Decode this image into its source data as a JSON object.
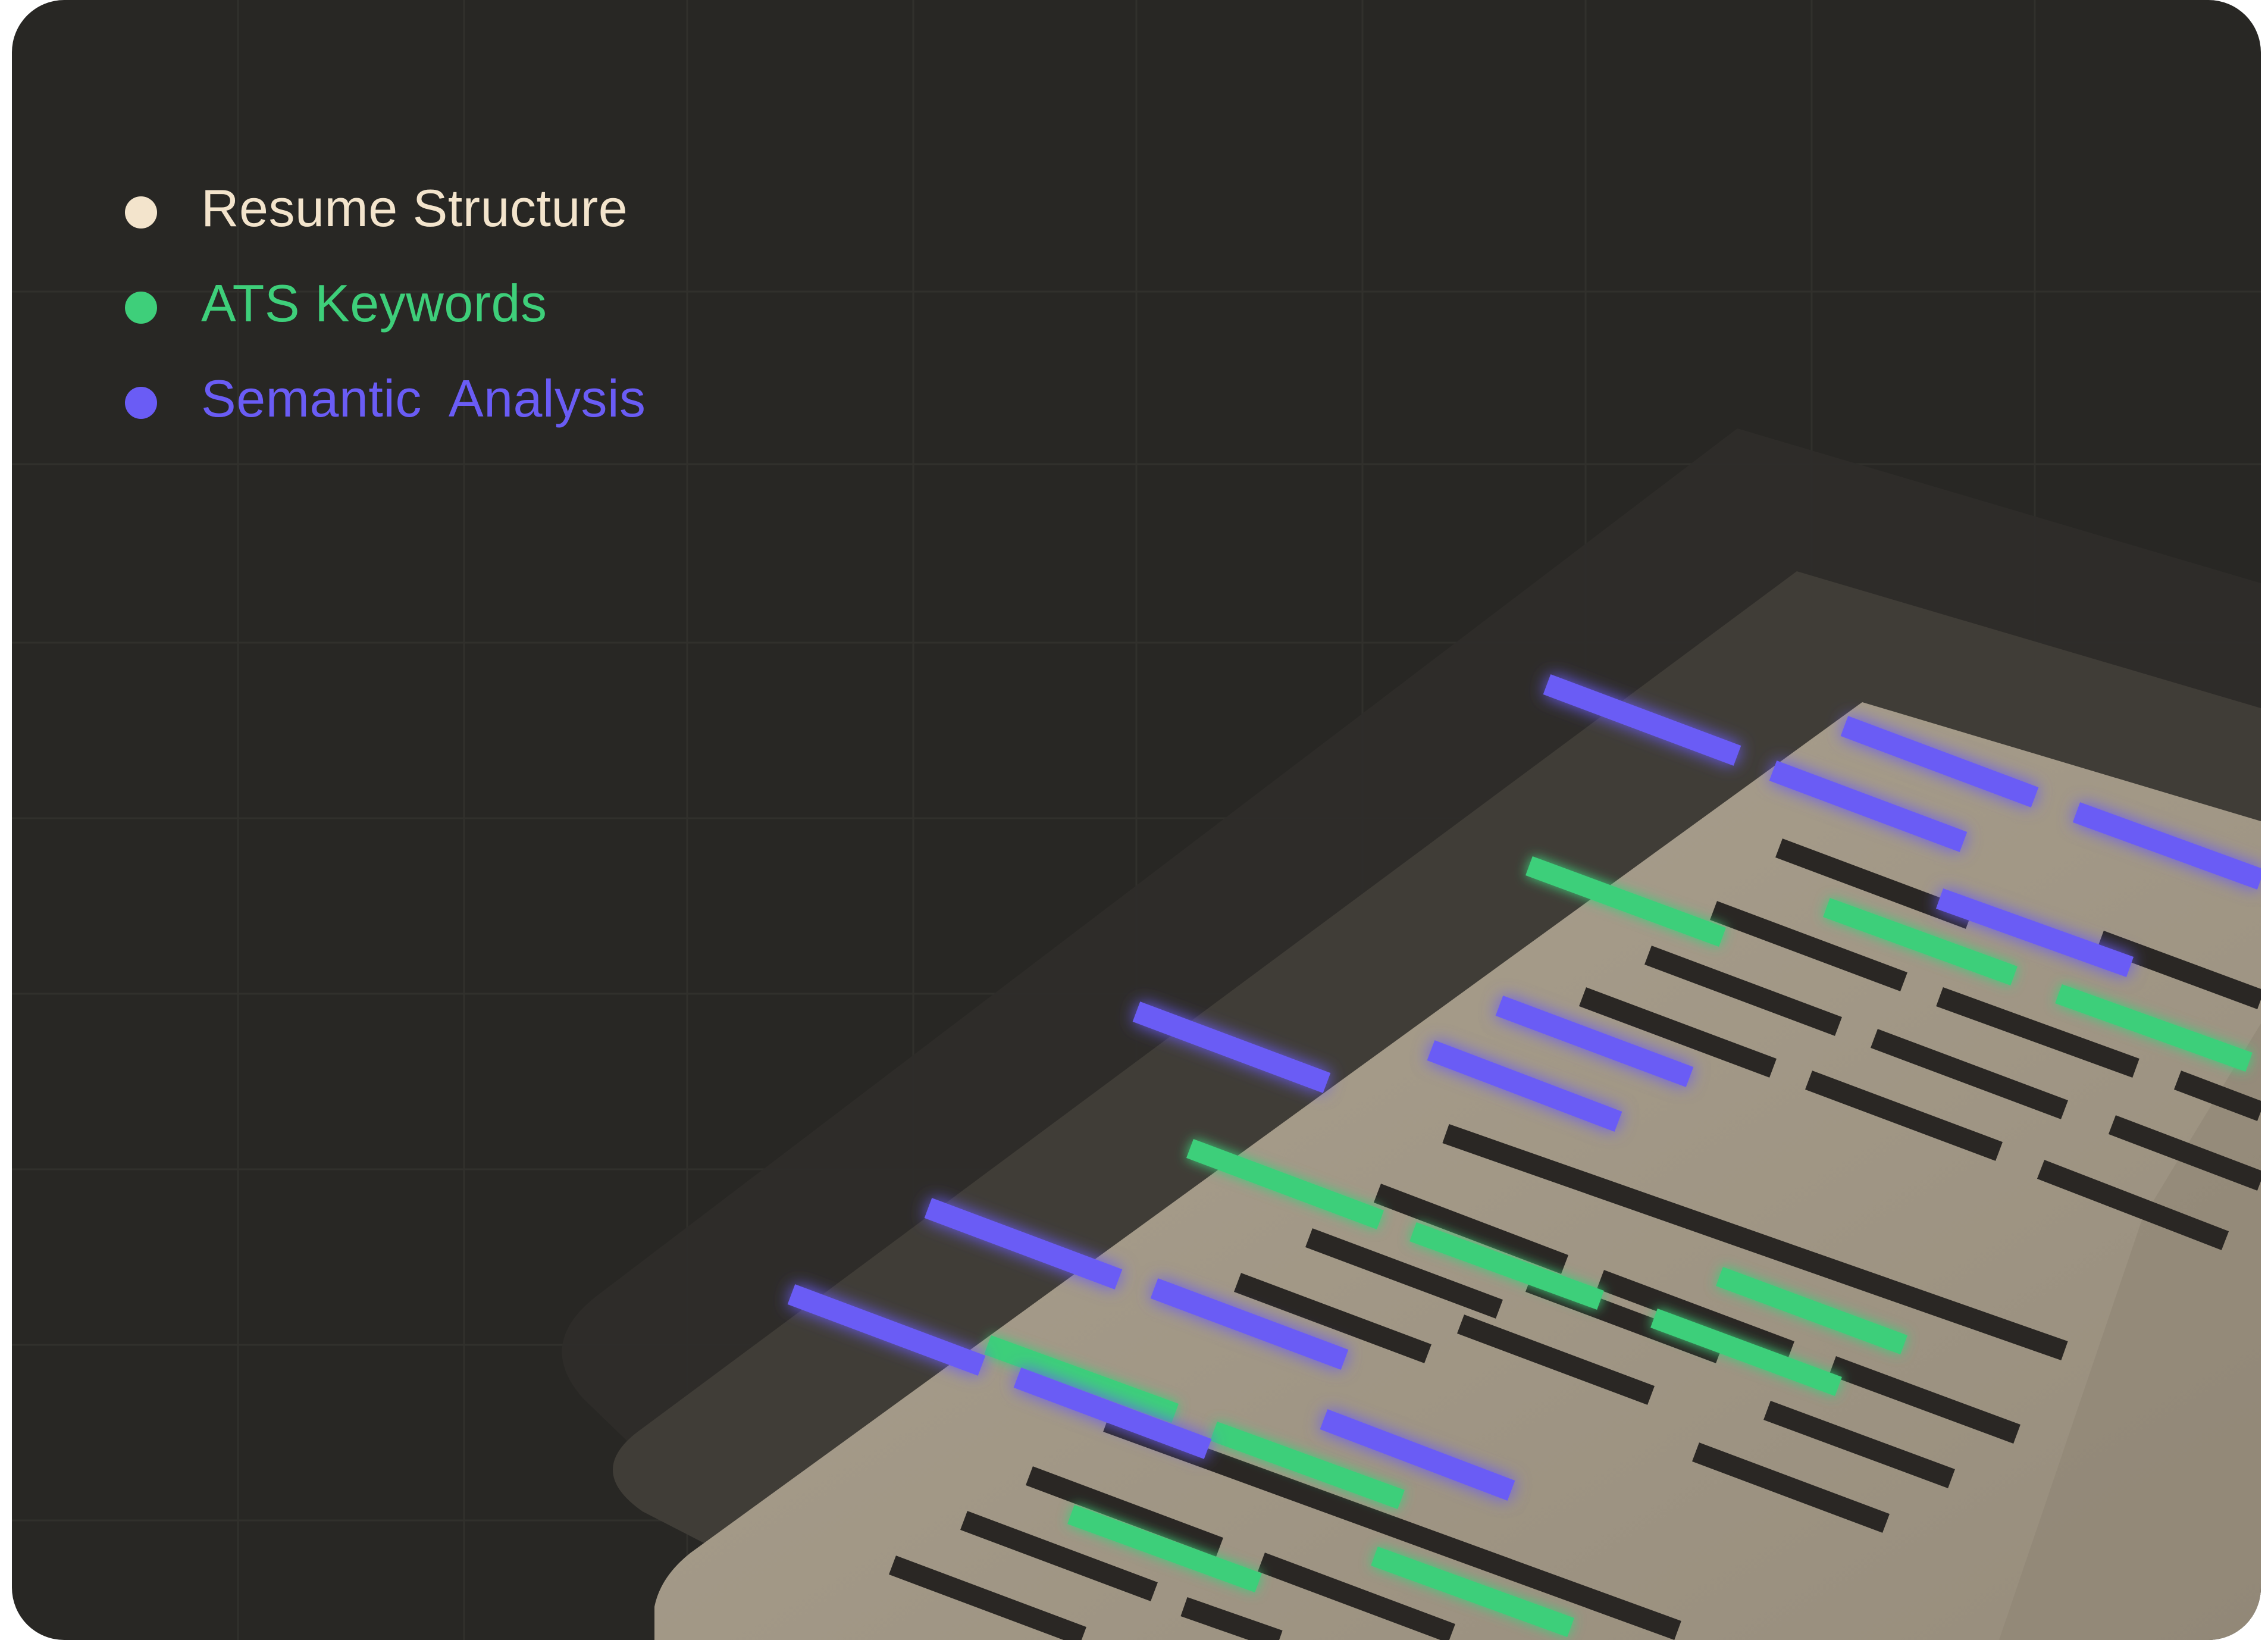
{
  "legend": {
    "items": [
      {
        "label": "Resume Structure",
        "color": "#F3E4CC",
        "icon": "circle-dot-icon"
      },
      {
        "label": "ATS Keywords",
        "color": "#3ECF7A",
        "icon": "circle-dot-icon"
      },
      {
        "label": "Semantic  Analysis",
        "color": "#6A5CF5",
        "icon": "circle-dot-icon"
      }
    ]
  },
  "colors": {
    "background": "#282724",
    "paper": "#A59B8A",
    "structure_bar": "#2A2724",
    "keyword_bar": "#3ECF7A",
    "semantic_bar": "#6A5CF5"
  }
}
